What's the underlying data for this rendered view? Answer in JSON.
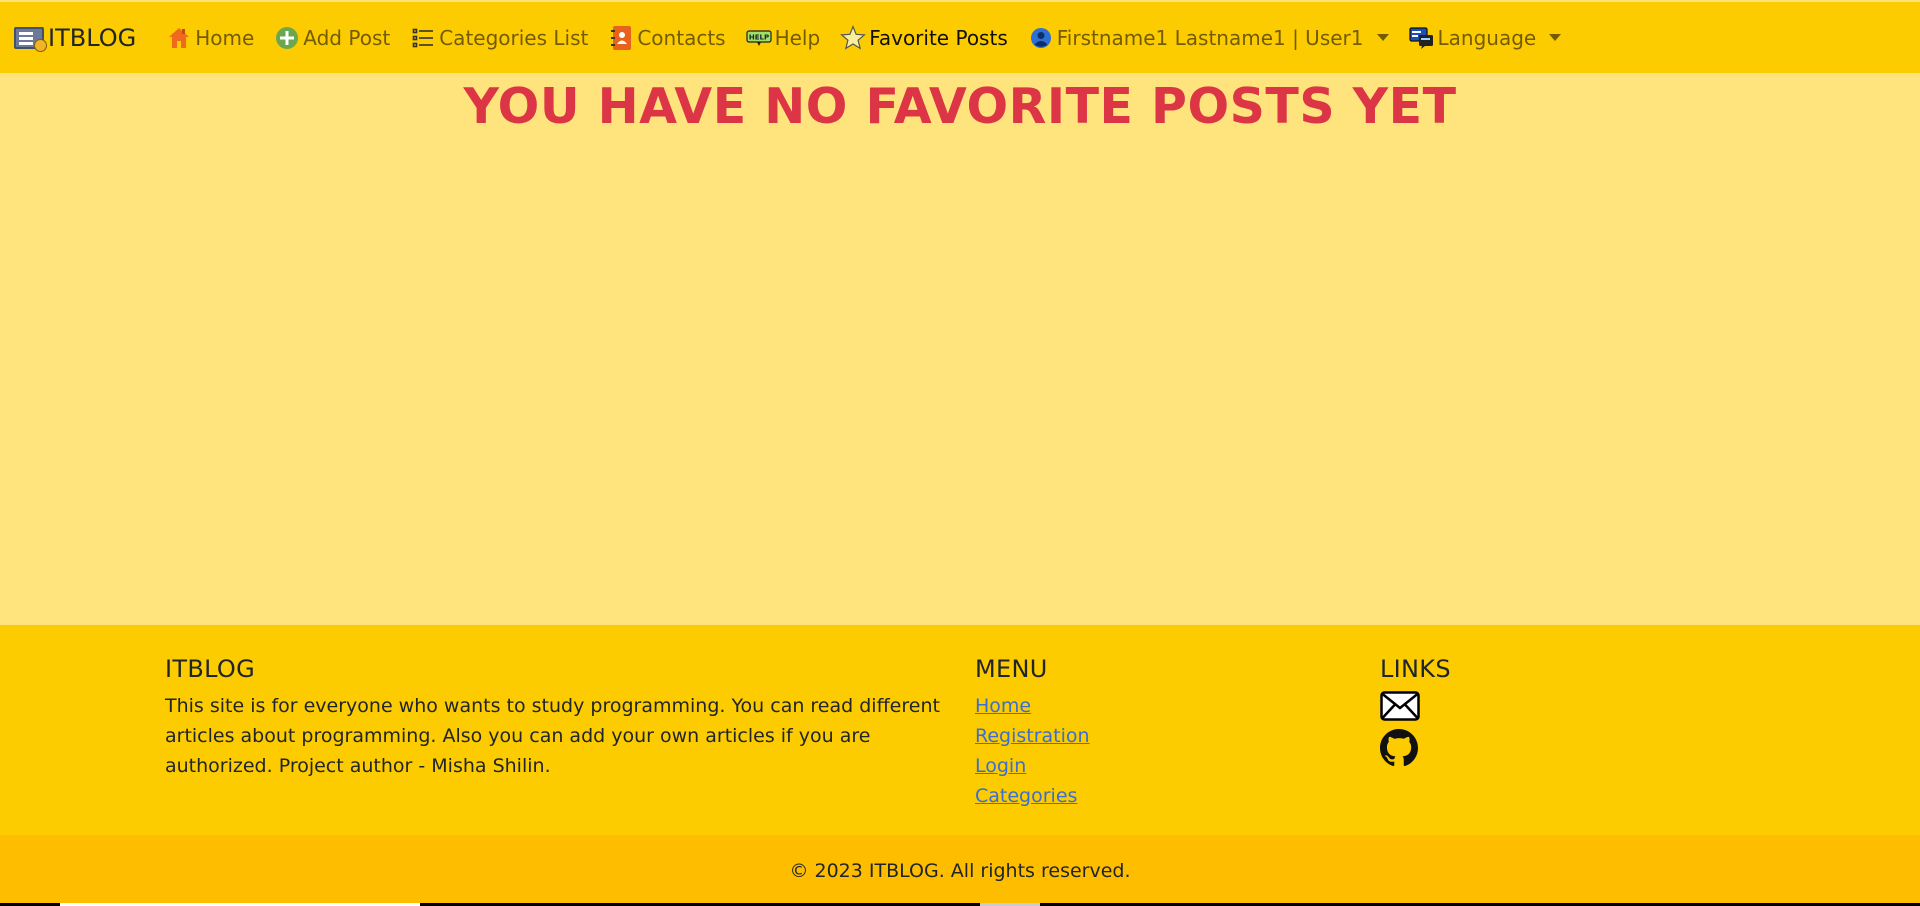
{
  "navbar": {
    "brand": "ITBLOG",
    "items": [
      {
        "label": "Home",
        "icon": "home-icon"
      },
      {
        "label": "Add Post",
        "icon": "add-circle-icon"
      },
      {
        "label": "Categories List",
        "icon": "list-icon"
      },
      {
        "label": "Contacts",
        "icon": "contacts-book-icon"
      },
      {
        "label": "Help",
        "icon": "help-sign-icon"
      },
      {
        "label": "Favorite Posts",
        "icon": "star-icon",
        "active": true
      }
    ],
    "user": {
      "label": "Firstname1 Lastname1 | User1",
      "icon": "user-circle-icon"
    },
    "language": {
      "label": "Language",
      "icon": "language-icon"
    },
    "help_badge": "HELP"
  },
  "main": {
    "title": "YOU HAVE NO FAVORITE POSTS YET"
  },
  "footer": {
    "about": {
      "heading": "ITBLOG",
      "text": "This site is for everyone who wants to study programming. You can read different articles about programming. Also you can add your own articles if you are authorized. Project author - Misha Shilin."
    },
    "menu": {
      "heading": "MENU",
      "links": [
        "Home",
        "Registration",
        "Login",
        "Categories"
      ]
    },
    "links": {
      "heading": "LINKS",
      "icons": [
        "envelope-icon",
        "github-icon"
      ]
    },
    "copyright": "© 2023 ITBLOG. All rights reserved."
  },
  "colors": {
    "navbar_bg": "#fccb00",
    "page_bg": "#ffe47e",
    "title": "#dc3545",
    "copyright_bg": "#ffbd00",
    "link": "#3a6ed1"
  }
}
